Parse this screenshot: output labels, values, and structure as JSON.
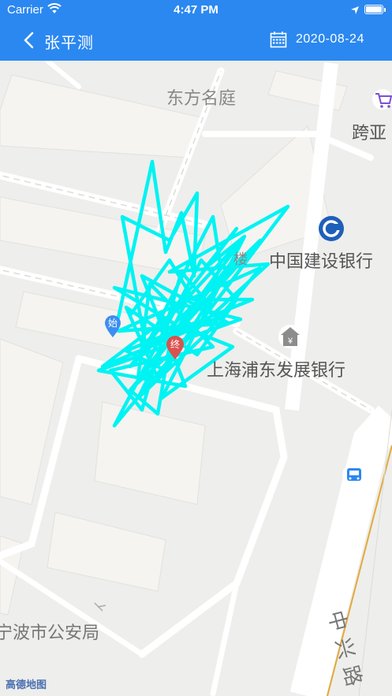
{
  "status_bar": {
    "carrier": "Carrier",
    "time": "4:47 PM"
  },
  "nav": {
    "title": "张平测",
    "date": "2020-08-24"
  },
  "map": {
    "pois": {
      "dongfang": "东方名庭",
      "kuaya": "跨亚",
      "ccb": "中国建设银行",
      "spdb": "上海浦东发展银行",
      "police": "宁波市公安局",
      "road": "中兴路",
      "lou": "楼"
    },
    "start_marker": "始",
    "end_marker": "终",
    "track_color": "#00f3f3",
    "attribution": "高德地图"
  }
}
